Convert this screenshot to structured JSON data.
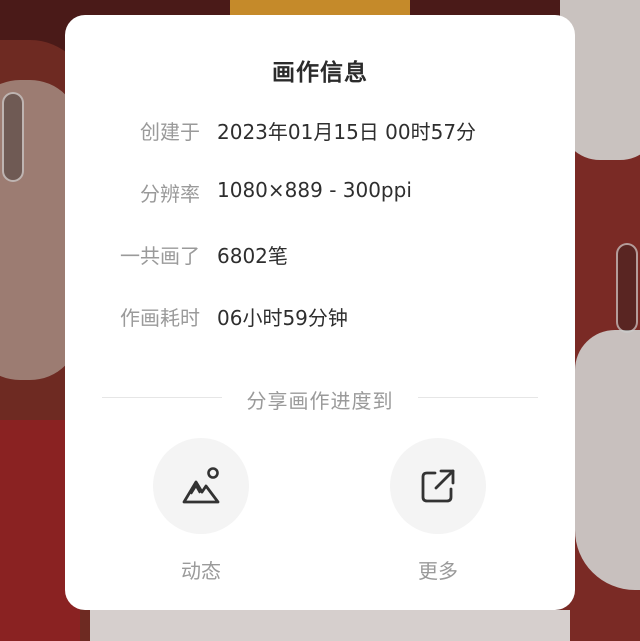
{
  "dialog": {
    "title": "画作信息",
    "info": [
      {
        "label": "创建于",
        "value": "2023年01月15日 00时57分"
      },
      {
        "label": "分辨率",
        "value": "1080×889 - 300ppi"
      },
      {
        "label": "一共画了",
        "value": "6802笔"
      },
      {
        "label": "作画耗时",
        "value": "06小时59分钟"
      }
    ],
    "share_heading": "分享画作进度到",
    "share_targets": [
      {
        "label": "动态",
        "icon": "mountain-image-icon"
      },
      {
        "label": "更多",
        "icon": "external-share-icon"
      }
    ]
  },
  "colors": {
    "dialog_bg": "#ffffff",
    "label_gray": "#9a9a9a",
    "value_dark": "#2e2e2e",
    "share_circle": "#f4f4f4"
  }
}
